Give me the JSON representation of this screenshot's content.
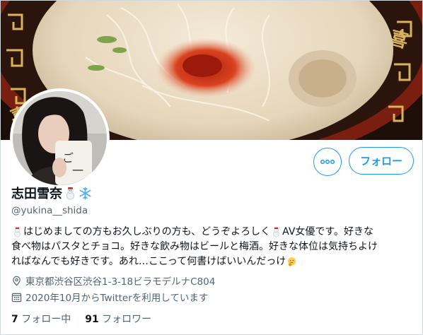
{
  "profile": {
    "display_name": "志田雪奈",
    "handle": "@yukina__shida",
    "bio_lines": [
      "はじめましての方もお久しぶりの方も、どうぞよろしく",
      " AV女優です。好きな",
      "食べ物はパスタとチョコ。好きな飲み物はビールと梅酒。好きな体位は気持ちよけ",
      "ればなんでも好きです。あれ…ここって何書けばいいんだっけ"
    ],
    "location": "東京都渋谷区渋谷1-3-18ビラモデルナC804",
    "joined": "2020年10月からTwitterを利用しています",
    "following_count": "7",
    "following_label": "フォロー中",
    "followers_count": "91",
    "followers_label": "フォロワー"
  },
  "actions": {
    "follow_label": "フォロー",
    "more_label": "•••"
  },
  "icons": {
    "name_emojis": [
      "snowman-icon",
      "snowflake-icon"
    ],
    "bio_emojis": [
      "snowman-icon",
      "snowman-icon",
      "thinking-face-icon"
    ],
    "location": "location-pin-icon",
    "joined": "calendar-icon"
  },
  "colors": {
    "accent": "#1d9bf0",
    "text_primary": "#0f1419",
    "text_secondary": "#536471"
  }
}
